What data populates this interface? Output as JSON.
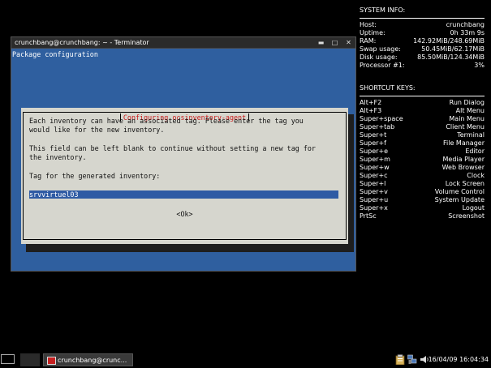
{
  "conky": {
    "system_title": "SYSTEM INFO:",
    "system_rows": [
      {
        "label": "Host:",
        "value": "crunchbang"
      },
      {
        "label": "Uptime:",
        "value": "0h 33m 9s"
      },
      {
        "label": "RAM:",
        "value": "142.92MiB/248.69MiB"
      },
      {
        "label": "Swap usage:",
        "value": "50.45MiB/62.17MiB"
      },
      {
        "label": "Disk usage:",
        "value": "85.50MiB/124.34MiB"
      },
      {
        "label": "Processor #1:",
        "value": "3%"
      }
    ],
    "shortcut_title": "SHORTCUT KEYS:",
    "shortcut_rows": [
      {
        "label": "Alt+F2",
        "value": "Run Dialog"
      },
      {
        "label": "Alt+F3",
        "value": "Alt Menu"
      },
      {
        "label": "Super+space",
        "value": "Main Menu"
      },
      {
        "label": "Super+tab",
        "value": "Client Menu"
      },
      {
        "label": "Super+t",
        "value": "Terminal"
      },
      {
        "label": "Super+f",
        "value": "File Manager"
      },
      {
        "label": "Super+e",
        "value": "Editor"
      },
      {
        "label": "Super+m",
        "value": "Media Player"
      },
      {
        "label": "Super+w",
        "value": "Web Browser"
      },
      {
        "label": "Super+c",
        "value": "Clock"
      },
      {
        "label": "Super+l",
        "value": "Lock Screen"
      },
      {
        "label": "Super+v",
        "value": "Volume Control"
      },
      {
        "label": "Super+u",
        "value": "System Update"
      },
      {
        "label": "Super+x",
        "value": "Logout"
      },
      {
        "label": "PrtSc",
        "value": "Screenshot"
      }
    ]
  },
  "window": {
    "title": "crunchbang@crunchbang: ~ - Terminator",
    "buttons": [
      {
        "name": "minimize",
        "glyph": "▬",
        "icon": "minimize-icon"
      },
      {
        "name": "maximize",
        "glyph": "□",
        "icon": "maximize-icon"
      },
      {
        "name": "close",
        "glyph": "✕",
        "icon": "close-icon"
      }
    ],
    "background_color": "#2f5f9f"
  },
  "terminal": {
    "header": "Package configuration",
    "dialog": {
      "title": "Configuring ocsinventory-agent",
      "lines": [
        "Each inventory can have an associated tag. Please enter the tag you",
        "would like for the new inventory.",
        "",
        "This field can be left blank to continue without setting a new tag for",
        "the inventory.",
        "",
        "Tag for the generated inventory:"
      ],
      "input_value": "srvvirtuel03",
      "ok_label": "<Ok>",
      "title_color": "#cc1a1a",
      "input_color": "#2f5ba4"
    }
  },
  "taskbar": {
    "task_label": "crunchbang@crunc...",
    "tray_icons": [
      "clipboard-icon",
      "network-icon",
      "volume-icon"
    ],
    "clock": "16/04/09 16:04:34"
  }
}
